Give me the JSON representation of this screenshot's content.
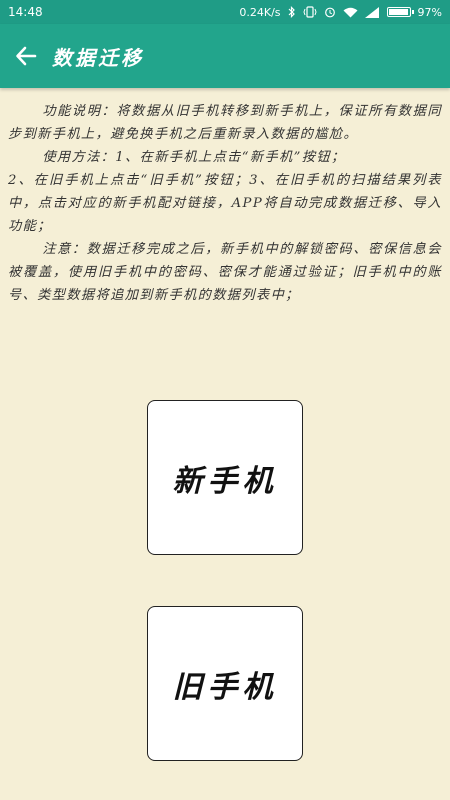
{
  "status_bar": {
    "time": "14:48",
    "network_speed": "0.24K/s",
    "battery_percent": "97%",
    "battery_level": 0.97,
    "icons": [
      "bluetooth-icon",
      "vibrate-icon",
      "alarm-icon",
      "wifi-icon",
      "signal-icon",
      "battery-icon"
    ]
  },
  "app_bar": {
    "title": "数据迁移",
    "back_icon": "arrow-left-icon"
  },
  "description": {
    "intro": "功能说明：将数据从旧手机转移到新手机上，保证所有数据同步到新手机上，避免换手机之后重新录入数据的尴尬。",
    "usage_1": "使用方法：1、在新手机上点击“新手机”按钮；",
    "usage_2": "2、在旧手机上点击“旧手机”按钮；3、在旧手机的扫描结果列表中，点击对应的新手机配对链接，APP将自动完成数据迁移、导入功能；",
    "note": "注意：数据迁移完成之后，新手机中的解锁密码、密保信息会被覆盖，使用旧手机中的密码、密保才能通过验证；旧手机中的账号、类型数据将追加到新手机的数据列表中；"
  },
  "buttons": {
    "new_phone": "新手机",
    "old_phone": "旧手机"
  },
  "colors": {
    "status_bar": "#1f9c86",
    "app_bar": "#22a58c",
    "background": "#f5efd6"
  }
}
